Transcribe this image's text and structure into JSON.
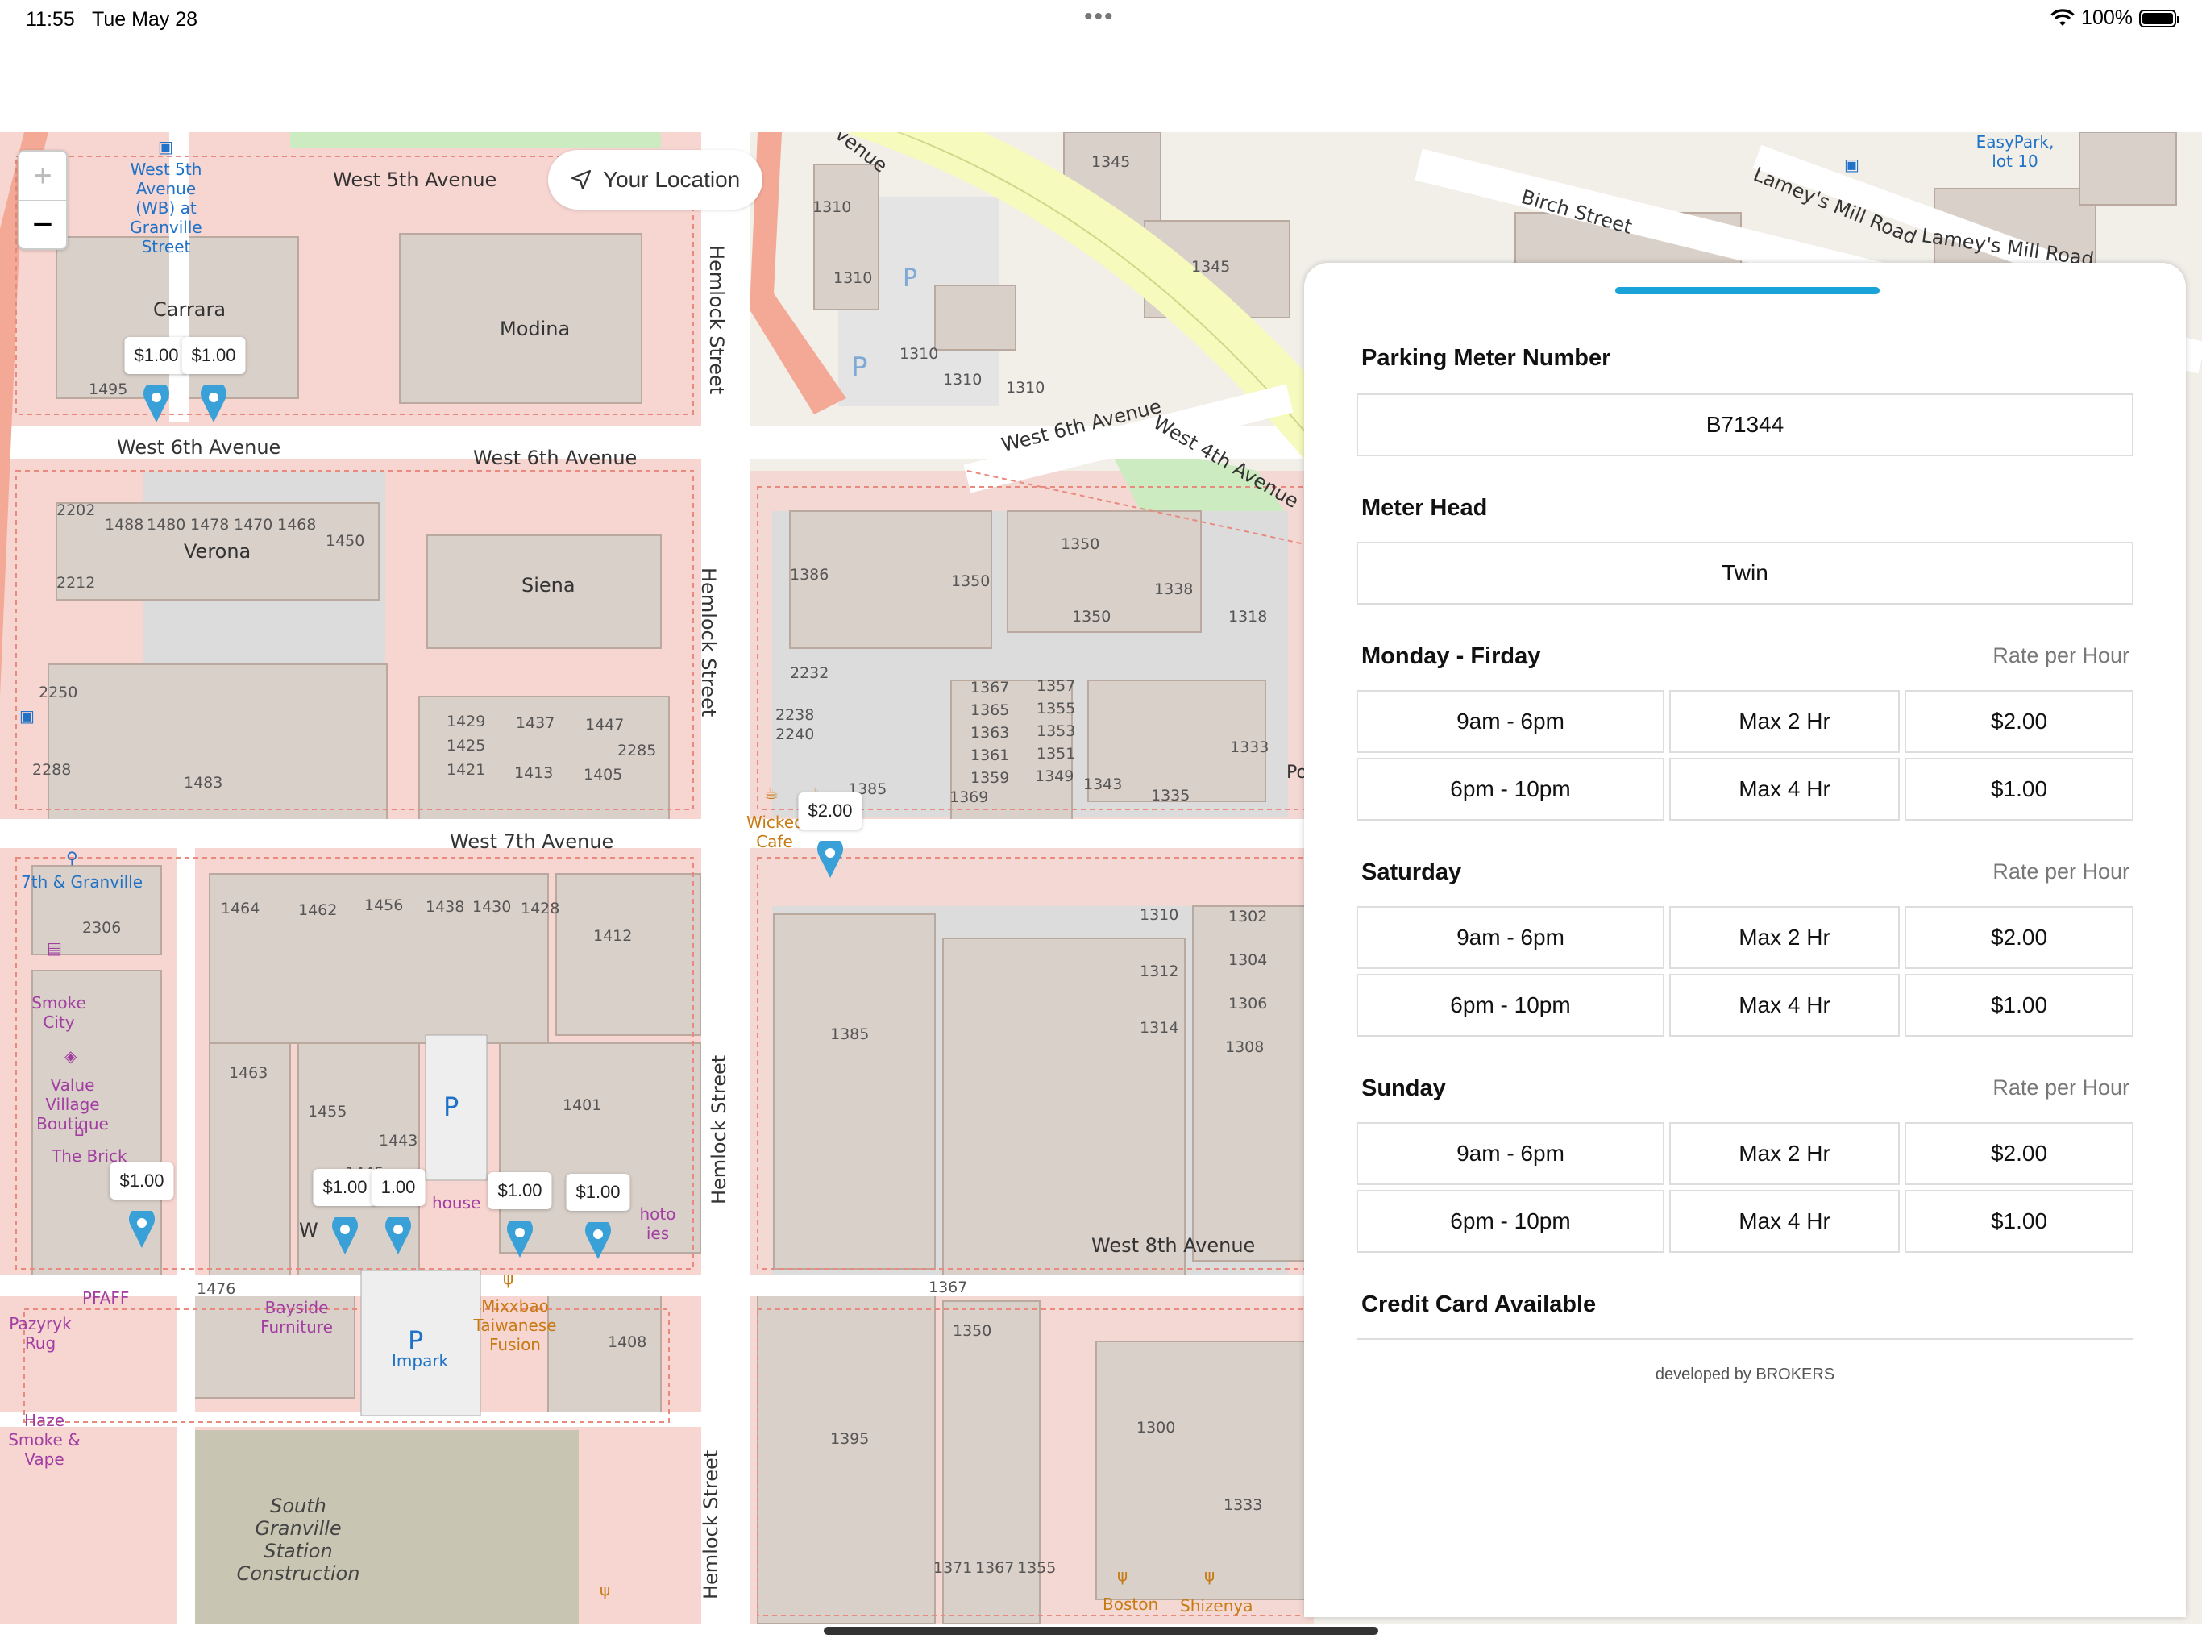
{
  "status_bar": {
    "time": "11:55",
    "date": "Tue May 28",
    "dots": "•••",
    "battery": "100%"
  },
  "map": {
    "zoom_in": "+",
    "zoom_out": "−",
    "your_location": "Your Location",
    "streets": {
      "w5th": "West 5th Avenue",
      "w6th_left": "West 6th Avenue",
      "w6th_mid": "West 6th Avenue",
      "w6th_right": "West 6th Avenue",
      "w4th": "West 4th Avenue",
      "w7th": "West 7th Avenue",
      "w8th": "West 8th Avenue",
      "w8th_left": "W",
      "hemlock_top": "Hemlock Street",
      "hemlock_mid": "Hemlock Street",
      "hemlock_low": "Hemlock Street",
      "hemlock_bottom": "Hemlock Street",
      "birch": "Birch Street",
      "lamey1": "Lamey's Mill Road",
      "lamey2": "Lamey's Mill Road",
      "venue": "venue"
    },
    "places": {
      "carrara": "Carrara",
      "modina": "Modina",
      "verona": "Verona",
      "siena": "Siena",
      "bus_stop": "West 5th Avenue (WB) at Granville Street",
      "granville_7th": "7th & Granville",
      "smoke_city": "Smoke City",
      "value_village": "Value Village Boutique",
      "the_brick": "The Brick",
      "pfaff": "PFAFF",
      "pazyryk": "Pazyryk Rug",
      "haze": "Haze Smoke & Vape",
      "bayside": "Bayside Furniture",
      "impark": "Impark",
      "mixxbao": "Mixxbao Taiwanese Fusion",
      "wicked": "Wicked Cafe",
      "south_granville": "South Granville Station Construction",
      "easypark": "EasyPark, lot 10",
      "house": "house",
      "photo": "hoto ies",
      "boston": "Boston",
      "shizenya": "Shizenya",
      "po": "Po",
      "shi": "Shi"
    },
    "numbers": {
      "n1495": "1495",
      "n2202": "2202",
      "n1488": "1488",
      "n1480": "1480",
      "n1478": "1478",
      "n1470": "1470",
      "n1468": "1468",
      "n1450": "1450",
      "n2212": "2212",
      "n2250": "2250",
      "n2288": "2288",
      "n1483": "1483",
      "n1429": "1429",
      "n1425": "1425",
      "n1421": "1421",
      "n1437": "1437",
      "n1413": "1413",
      "n1447": "1447",
      "n2285": "2285",
      "n1405": "1405",
      "n1310a": "1310",
      "n1310b": "1310",
      "n1310c": "1310",
      "n1310d": "1310",
      "n1310e": "1310",
      "n1345a": "1345",
      "n1345b": "1345",
      "n1386": "1386",
      "n1350a": "1350",
      "n1350b": "1350",
      "n1350c": "1350",
      "n1338": "1338",
      "n1318": "1318",
      "n2232": "2232",
      "n2238": "2238",
      "n2240": "2240",
      "n1385a": "1385",
      "n1367": "1367",
      "n1365": "1365",
      "n1363": "1363",
      "n1361": "1361",
      "n1359": "1359",
      "n1369": "1369",
      "n1357": "1357",
      "n1355": "1355",
      "n1353": "1353",
      "n1351": "1351",
      "n1349": "1349",
      "n1343": "1343",
      "n1335": "1335",
      "n1333a": "1333",
      "n2306": "2306",
      "n1464": "1464",
      "n1462": "1462",
      "n1456": "1456",
      "n1438": "1438",
      "n1430": "1430",
      "n1428": "1428",
      "n1412": "1412",
      "n1463": "1463",
      "n1455": "1455",
      "n1443": "1443",
      "n1445": "1445",
      "n1401": "1401",
      "n1385b": "1385",
      "n1310f": "1310",
      "n1312": "1312",
      "n1314": "1314",
      "n1302": "1302",
      "n1304": "1304",
      "n1306": "1306",
      "n1308": "1308",
      "n1476": "1476",
      "n1408": "1408",
      "n1367b": "1367",
      "n1350d": "1350",
      "n1395": "1395",
      "n1300": "1300",
      "n1333b": "1333",
      "n1371": "1371",
      "n1367c": "1367",
      "n1355b": "1355"
    },
    "parking_p": "P",
    "pins": [
      {
        "price": "$1.00"
      },
      {
        "price": "$1.00"
      },
      {
        "price": "$2.00"
      },
      {
        "price": "$1.00"
      },
      {
        "price": "$1.00"
      },
      {
        "price": "1.00"
      },
      {
        "price": "$1.00"
      },
      {
        "price": "$1.00"
      }
    ]
  },
  "panel": {
    "meter_number_label": "Parking Meter Number",
    "meter_number": "B71344",
    "meter_head_label": "Meter Head",
    "meter_head": "Twin",
    "rate_per_hour": "Rate per Hour",
    "schedules": [
      {
        "day": "Monday - Firday",
        "rows": [
          {
            "time": "9am - 6pm",
            "max": "Max 2 Hr",
            "rate": "$2.00"
          },
          {
            "time": "6pm - 10pm",
            "max": "Max 4 Hr",
            "rate": "$1.00"
          }
        ]
      },
      {
        "day": "Saturday",
        "rows": [
          {
            "time": "9am - 6pm",
            "max": "Max 2 Hr",
            "rate": "$2.00"
          },
          {
            "time": "6pm - 10pm",
            "max": "Max 4 Hr",
            "rate": "$1.00"
          }
        ]
      },
      {
        "day": "Sunday",
        "rows": [
          {
            "time": "9am - 6pm",
            "max": "Max 2 Hr",
            "rate": "$2.00"
          },
          {
            "time": "6pm - 10pm",
            "max": "Max 4 Hr",
            "rate": "$1.00"
          }
        ]
      }
    ],
    "credit_card_label": "Credit Card Available",
    "footer": "developed by BROKERS"
  },
  "colors": {
    "accent": "#1aa3d8",
    "pin": "#3aa0d8",
    "road_major": "#f7c9bc",
    "residential": "#f7d5d0",
    "building": "#d9d0c9"
  }
}
